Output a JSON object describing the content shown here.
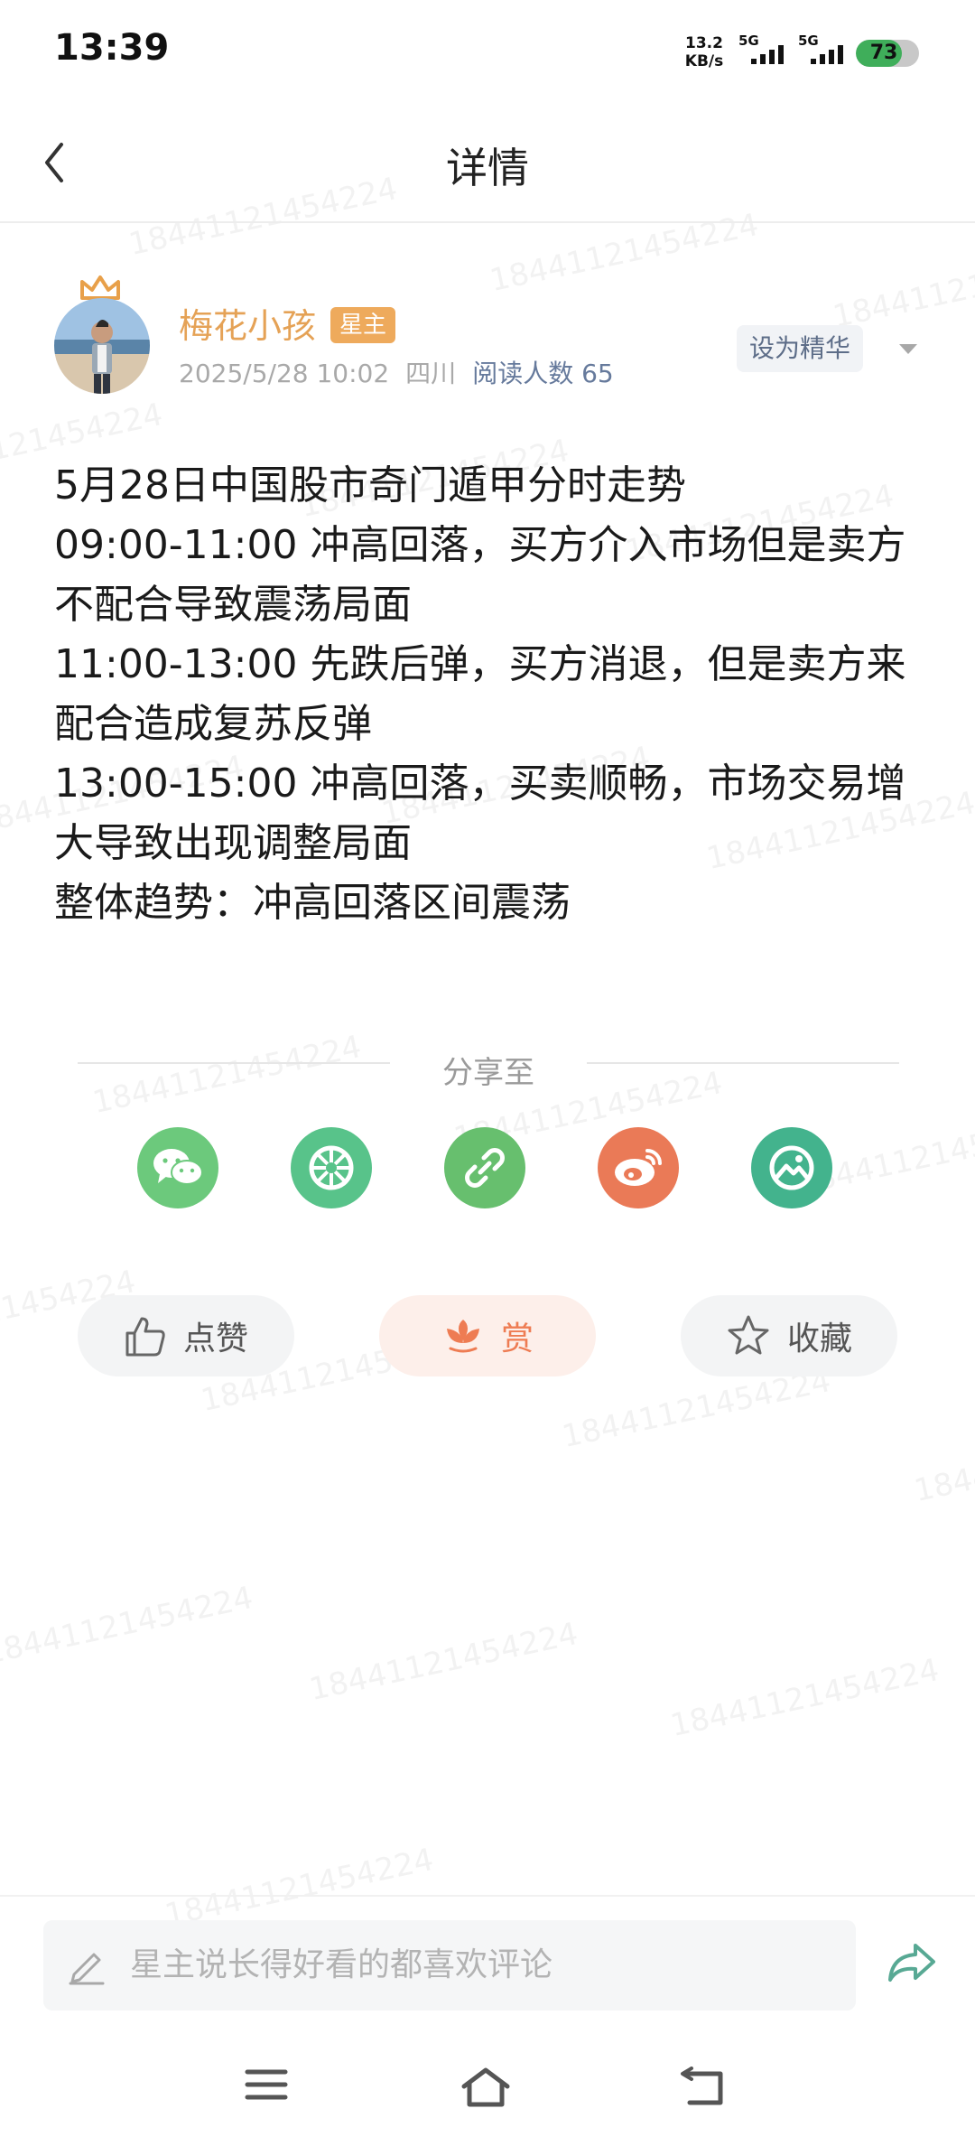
{
  "status_bar": {
    "time": "13:39",
    "net_speed_value": "13.2",
    "net_speed_unit": "KB/s",
    "sim1_label": "5G",
    "sim2_label": "5G",
    "battery_level": "73",
    "battery_fraction": 0.73
  },
  "nav": {
    "title": "详情"
  },
  "author": {
    "name": "梅花小孩",
    "badge": "星主",
    "datetime": "2025/5/28 10:02",
    "location": "四川",
    "reads": "阅读人数 65",
    "feature_button": "设为精华"
  },
  "post": {
    "lines": [
      "5月28日中国股市奇门遁甲分时走势",
      "09:00-11:00  冲高回落，买方介入市场但是卖方不配合导致震荡局面",
      "11:00-13:00  先跌后弹，买方消退，但是卖方来配合造成复苏反弹",
      "13:00-15:00  冲高回落，买卖顺畅，市场交易增大导致出现调整局面",
      "整体趋势：冲高回落区间震荡"
    ]
  },
  "share": {
    "label": "分享至",
    "targets": [
      {
        "icon": "wechat-icon",
        "color": "#6cc97c"
      },
      {
        "icon": "moments-icon",
        "color": "#58c38a"
      },
      {
        "icon": "link-icon",
        "color": "#67bf6e"
      },
      {
        "icon": "weibo-icon",
        "color": "#ea7a57"
      },
      {
        "icon": "image-icon",
        "color": "#43b38d"
      }
    ]
  },
  "actions": {
    "like": "点赞",
    "reward": "赏",
    "favorite": "收藏"
  },
  "watermark": "18441121454224",
  "comment": {
    "placeholder": "星主说长得好看的都喜欢评论"
  },
  "colors": {
    "accent_orange": "#e5a256",
    "reward_bg": "#fdefea",
    "reward_text": "#ee7c53",
    "share_green": "#58a994"
  }
}
